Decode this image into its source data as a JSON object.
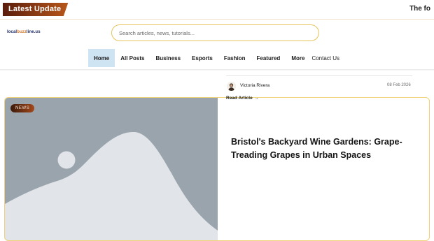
{
  "topbar": {
    "latest_label": "Latest Update",
    "ticker_text": "The fo"
  },
  "logo": {
    "part1": "local",
    "part2": "buzz",
    "part3": "line.us"
  },
  "search": {
    "placeholder": "Search articles, news, tutorials..."
  },
  "nav": {
    "items": [
      {
        "label": "Home",
        "active": true
      },
      {
        "label": "All Posts"
      },
      {
        "label": "Business"
      },
      {
        "label": "Esports"
      },
      {
        "label": "Fashion"
      },
      {
        "label": "Featured"
      },
      {
        "label": "More"
      },
      {
        "label": "Contact Us"
      }
    ]
  },
  "featured": {
    "badge": "NEWS",
    "title": "Bristol's Backyard Wine Gardens: Grape-Treading Grapes in Urban Spaces",
    "author": "Victoria Rivera",
    "date": "08 Feb 2026",
    "read_more": "Read Article",
    "arrow": "→"
  },
  "colors": {
    "accent_gold": "#e7c35b",
    "badge_brown": "#8a3a14",
    "nav_active_bg": "#cfe4f2",
    "image_bg": "#9aa4ad"
  }
}
